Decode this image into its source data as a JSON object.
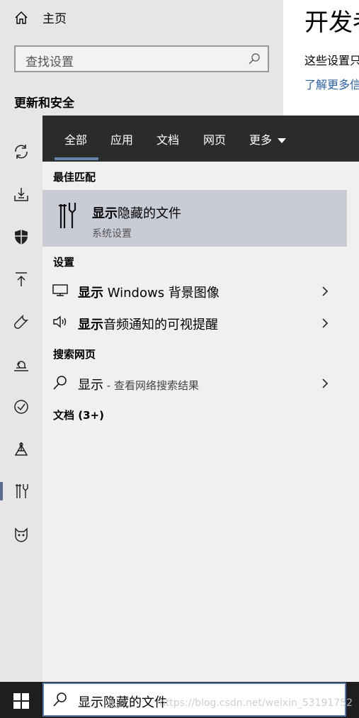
{
  "settings": {
    "home_label": "主页",
    "search_placeholder": "查找设置",
    "section_title": "更新和安全",
    "sidebar_icons": [
      "sync-icon",
      "delivery-icon",
      "shield-icon",
      "upload-icon",
      "wrench-icon",
      "recovery-icon",
      "check-circle-icon",
      "find-device-icon",
      "developer-tools-icon",
      "insider-icon"
    ],
    "right_title": "开发者",
    "right_text": "这些设置只",
    "right_link": "了解更多信"
  },
  "search_panel": {
    "tabs": [
      "全部",
      "应用",
      "文档",
      "网页",
      "更多"
    ],
    "best_match_heading": "最佳匹配",
    "best_match": {
      "title_bold": "显示",
      "title_rest": "隐藏的文件",
      "subtitle": "系统设置"
    },
    "settings_heading": "设置",
    "settings_results": [
      {
        "bold": "显示",
        "rest": " Windows 背景图像"
      },
      {
        "bold": "显示",
        "rest": "音频通知的可视提醒"
      }
    ],
    "web_heading": "搜索网页",
    "web_result": {
      "query": "显示",
      "hint": " - 查看网络搜索结果"
    },
    "docs_heading": "文档 (3+)"
  },
  "taskbar": {
    "search_text": "显示隐藏的文件",
    "watermark": "https://blog.csdn.net/weixin_53191752"
  }
}
